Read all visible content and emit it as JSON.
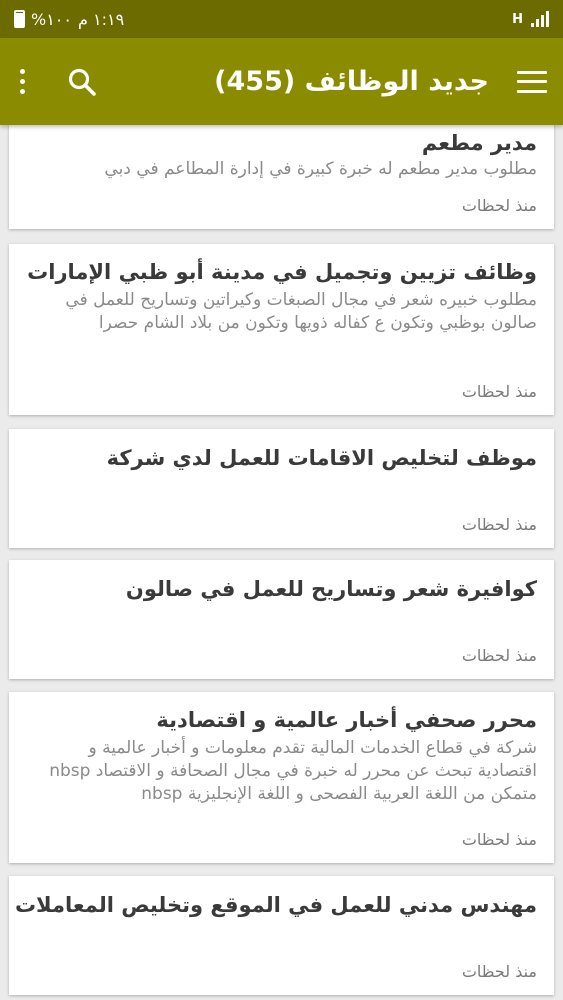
{
  "status_bar": {
    "time": "١:١٩ م",
    "battery": "%١٠٠",
    "network": "H"
  },
  "app_bar": {
    "title": "جديد الوظائف (455)",
    "icons": [
      "menu-icon",
      "search-icon",
      "more-vert-icon"
    ]
  },
  "jobs": [
    {
      "title": "مدير مطعم",
      "description": "مطلوب مدير مطعم له خبرة كبيرة في إدارة المطاعم في دبي",
      "time": "منذ لحظات"
    },
    {
      "title": "وظائف تزيين وتجميل في مدينة أبو ظبي الإمارات",
      "description": "مطلوب خبيره شعر في مجال الصبغات وكيراتين وتساريح للعمل في صالون بوظبي وتكون ع كفاله ذويها وتكون من بلاد الشام حصرا",
      "time": "منذ لحظات"
    },
    {
      "title": "موظف لتخليص الاقامات للعمل لدي شركة",
      "description": "",
      "time": "منذ لحظات"
    },
    {
      "title": "كوافيرة شعر وتساريح للعمل في صالون",
      "description": "",
      "time": "منذ لحظات"
    },
    {
      "title": "محرر صحفي أخبار عالمية و اقتصادية",
      "description": "شركة في قطاع الخدمات المالية تقدم معلومات و أخبار عالمية و اقتصادية تبحث عن محرر له خبرة في مجال الصحافة و الاقتصاد nbsp متمكن من اللغة العربية الفصحى و اللغة الإنجليزية nbsp",
      "time": "منذ لحظات"
    },
    {
      "title": "مهندس مدني للعمل في الموقع وتخليص المعاملات",
      "description": "",
      "time": "منذ لحظات"
    }
  ]
}
